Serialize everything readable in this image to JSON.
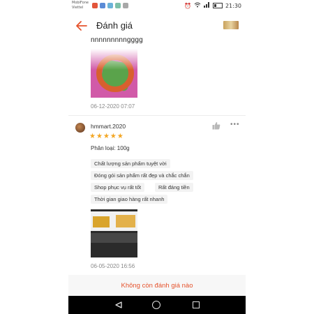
{
  "status_bar": {
    "carrier_lines": [
      "MobiFone",
      "Viettel"
    ],
    "time": "21:30",
    "app_icon_colors": [
      "#e2553b",
      "#5b8bd6",
      "#6bb3d8",
      "#7dc0a8",
      "#a8a8a8"
    ]
  },
  "header": {
    "title": "Đánh giá",
    "back_icon": "arrow-left-icon",
    "accent_color": "#e5532d"
  },
  "reviews": [
    {
      "text": "nnnnnnnnngggg",
      "date": "06-12-2020 07:07"
    },
    {
      "username": "hmmart.2020",
      "rating": 5,
      "variant": "Phân loại: 100g",
      "tags": [
        "Chất lượng sản phẩm tuyệt vời",
        "Đóng gói sản phẩm rất đẹp và chắc chắn",
        "Shop phục vụ rất tốt",
        "Rất đáng tiền",
        "Thời gian giao hàng rất nhanh"
      ],
      "date": "06-05-2020 16:56"
    }
  ],
  "footer": {
    "message": "Không còn đánh giá nào"
  },
  "colors": {
    "star": "#f3a623",
    "tag_bg": "#f3f3f3"
  }
}
